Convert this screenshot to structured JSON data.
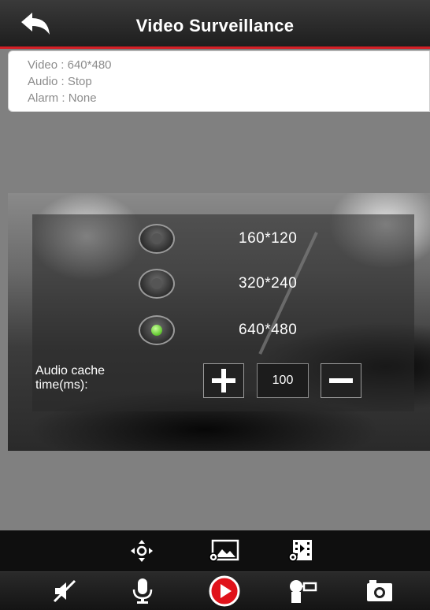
{
  "header": {
    "title": "Video Surveillance"
  },
  "status": {
    "video_label": "Video :",
    "video_value": "640*480",
    "audio_label": "Audio :",
    "audio_value": "Stop",
    "alarm_label": "Alarm :",
    "alarm_value": "None"
  },
  "settings": {
    "resolutions": [
      {
        "label": "160*120",
        "selected": false
      },
      {
        "label": "320*240",
        "selected": false
      },
      {
        "label": "640*480",
        "selected": true
      }
    ],
    "audio_cache_label": "Audio cache time(ms):",
    "audio_cache_value": "100"
  },
  "toolbar_top_icons": [
    "ptz-direction-icon",
    "image-settings-icon",
    "video-settings-icon"
  ],
  "toolbar_bottom_icons": [
    "speaker-mute-icon",
    "microphone-icon",
    "play-record-icon",
    "ir-light-icon",
    "camera-snapshot-icon"
  ],
  "colors": {
    "accent_red": "#d31f26",
    "selected_green": "#5fc42d",
    "play_red": "#e0121a"
  }
}
